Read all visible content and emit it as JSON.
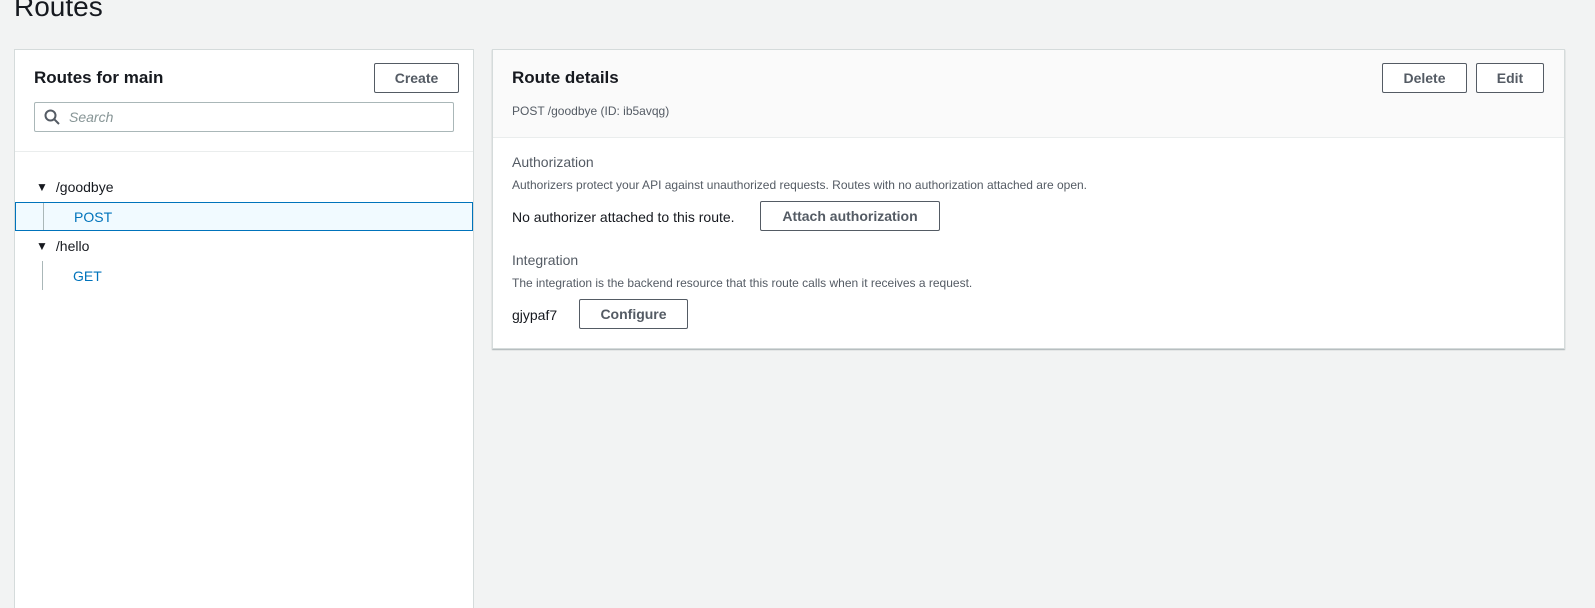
{
  "page": {
    "title": "Routes"
  },
  "left": {
    "title": "Routes for main",
    "create_label": "Create",
    "search_placeholder": "Search",
    "routes": [
      {
        "path": "/goodbye",
        "methods": [
          "POST"
        ]
      },
      {
        "path": "/hello",
        "methods": [
          "GET"
        ]
      }
    ]
  },
  "details": {
    "title": "Route details",
    "subtitle": "POST /goodbye (ID: ib5avqg)",
    "delete_label": "Delete",
    "edit_label": "Edit",
    "authorization": {
      "title": "Authorization",
      "desc": "Authorizers protect your API against unauthorized requests. Routes with no authorization attached are open.",
      "status": "No authorizer attached to this route.",
      "button_label": "Attach authorization"
    },
    "integration": {
      "title": "Integration",
      "desc": "The integration is the backend resource that this route calls when it receives a request.",
      "id": "gjypaf7",
      "button_label": "Configure"
    }
  },
  "colors": {
    "link": "#0073bb",
    "selected_bg": "#f1faff",
    "page_bg": "#f2f3f3"
  },
  "icons": {
    "search": "search-icon",
    "expand": "caret-down-icon"
  }
}
